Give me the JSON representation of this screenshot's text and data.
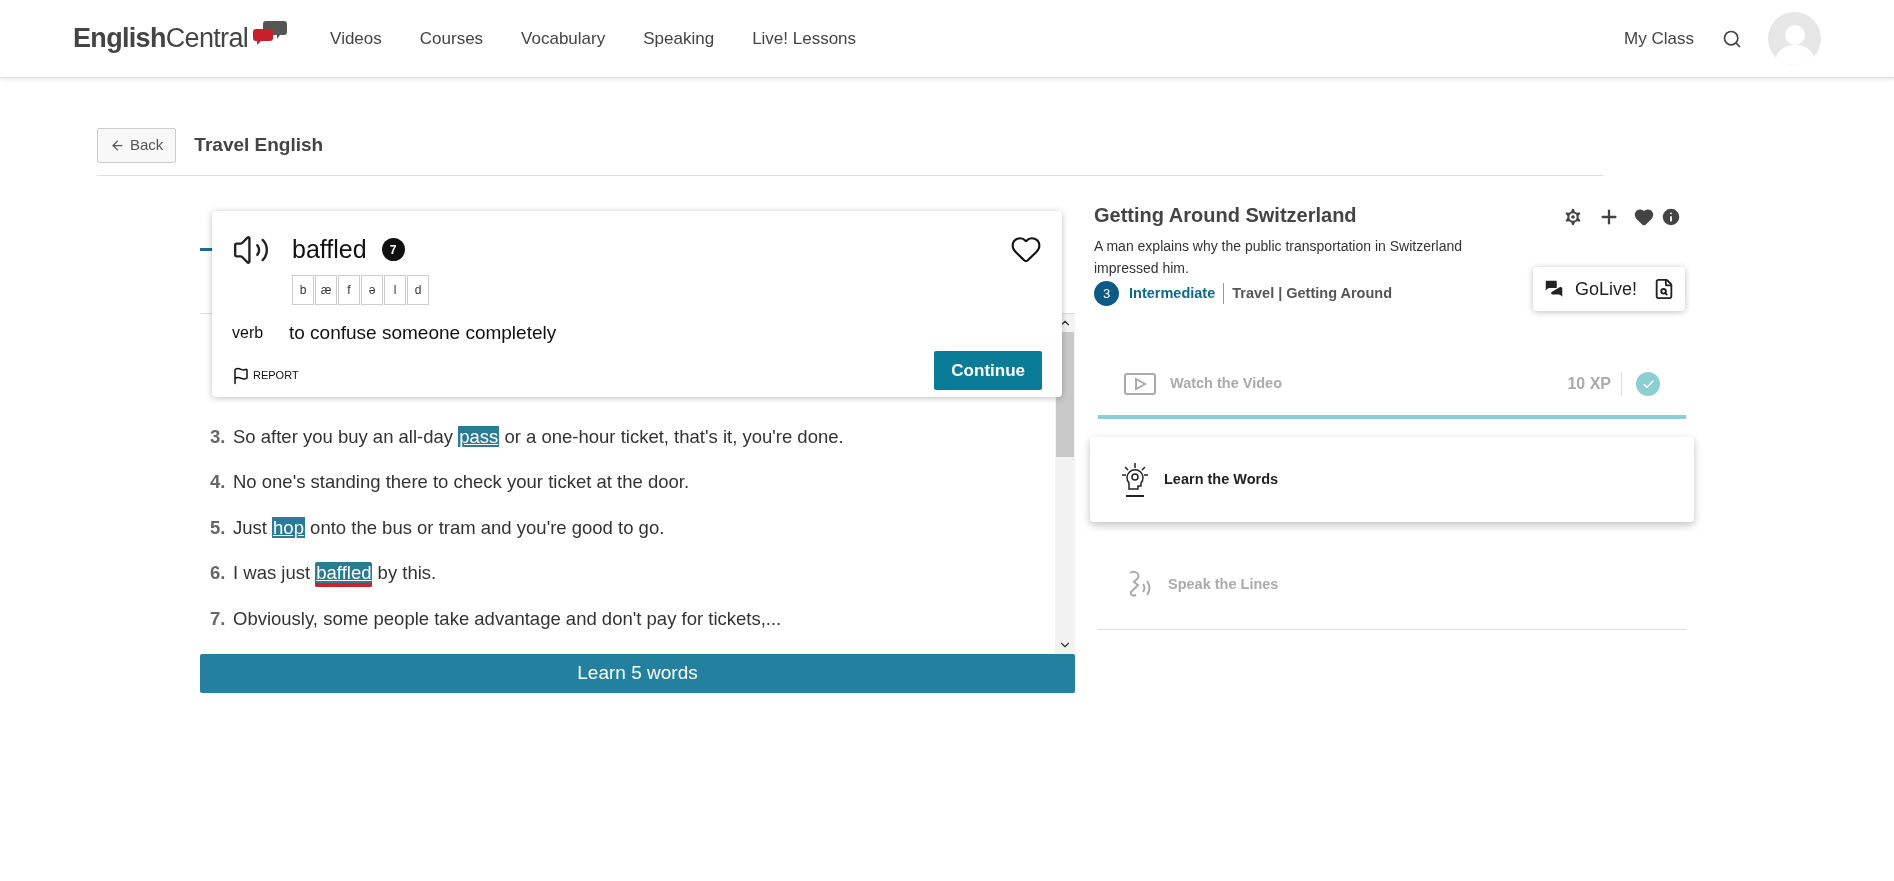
{
  "header": {
    "logo_first": "English",
    "logo_second": "Central",
    "nav": [
      "Videos",
      "Courses",
      "Vocabulary",
      "Speaking",
      "Live! Lessons"
    ],
    "my_class": "My Class"
  },
  "breadcrumb": {
    "back": "Back",
    "title": "Travel English"
  },
  "word_card": {
    "word": "baffled",
    "count": "7",
    "phonemes": [
      "b",
      "æ",
      "f",
      "ə",
      "l",
      "d"
    ],
    "part_of_speech": "verb",
    "definition": "to confuse someone completely",
    "report": "REPORT",
    "continue": "Continue",
    "favorited": false
  },
  "lines": [
    {
      "number": "3.",
      "segments": [
        {
          "text": "So after you buy an all-day ",
          "highlight": false,
          "selected": false
        },
        {
          "text": "pass",
          "highlight": true,
          "selected": false
        },
        {
          "text": " or a one-hour ticket, that's it, you're done.",
          "highlight": false,
          "selected": false
        }
      ]
    },
    {
      "number": "4.",
      "segments": [
        {
          "text": "No one's standing there to check your ticket at the door.",
          "highlight": false,
          "selected": false
        }
      ]
    },
    {
      "number": "5.",
      "segments": [
        {
          "text": "Just ",
          "highlight": false,
          "selected": false
        },
        {
          "text": "hop",
          "highlight": true,
          "selected": false
        },
        {
          "text": " onto the bus or tram and you're good to go.",
          "highlight": false,
          "selected": false
        }
      ]
    },
    {
      "number": "6.",
      "segments": [
        {
          "text": "I was just ",
          "highlight": false,
          "selected": false
        },
        {
          "text": "baffled",
          "highlight": true,
          "selected": true
        },
        {
          "text": " by this.",
          "highlight": false,
          "selected": false
        }
      ]
    },
    {
      "number": "7.",
      "segments": [
        {
          "text": "Obviously, some people take advantage and don't pay for tickets,...",
          "highlight": false,
          "selected": false
        }
      ]
    }
  ],
  "learn_button": "Learn 5 words",
  "video": {
    "title": "Getting Around Switzerland",
    "description": "A man explains why the public transportation in Switzerland impressed him.",
    "level_number": "3",
    "level": "Intermediate",
    "category": "Travel | Getting Around",
    "golive": "GoLive!"
  },
  "steps": [
    {
      "kind": "watch",
      "label": "Watch the Video",
      "xp": "10 XP",
      "completed": true,
      "selected": false
    },
    {
      "kind": "learn",
      "label": "Learn the Words",
      "completed": false,
      "selected": true
    },
    {
      "kind": "speak",
      "label": "Speak the Lines",
      "completed": false,
      "selected": false
    }
  ]
}
